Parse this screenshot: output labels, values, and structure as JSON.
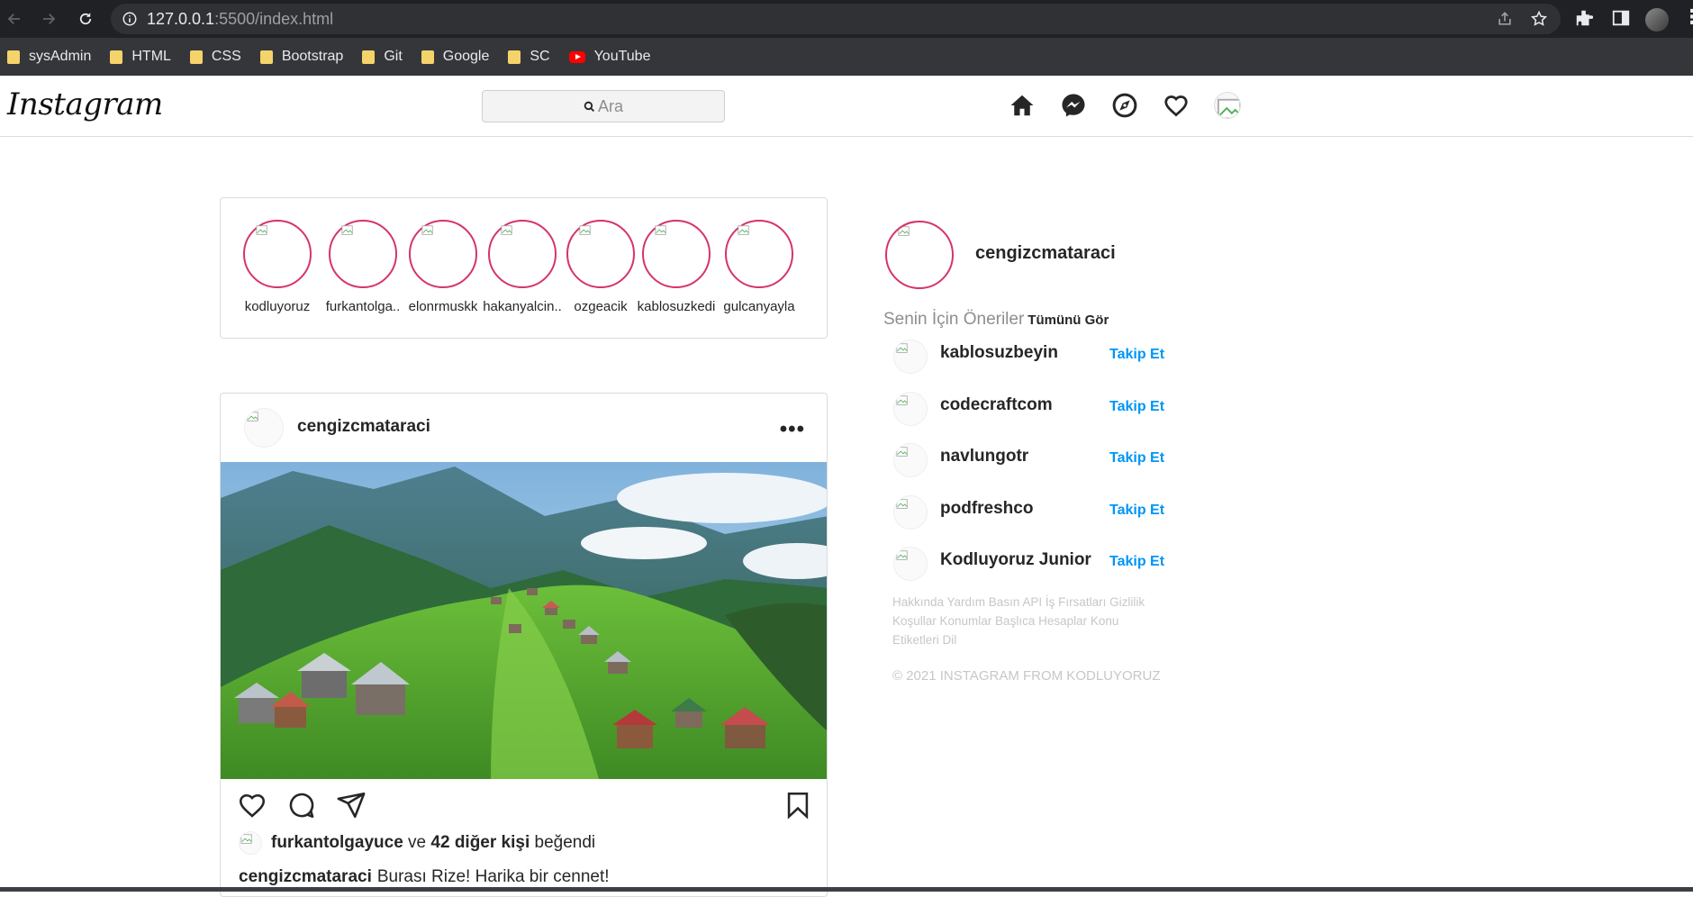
{
  "browser": {
    "url_host": "127.0.0.1",
    "url_path": ":5500/index.html",
    "bookmarks": [
      {
        "label": "sysAdmin",
        "icon": "folder-icon"
      },
      {
        "label": "HTML",
        "icon": "folder-icon"
      },
      {
        "label": "CSS",
        "icon": "folder-icon"
      },
      {
        "label": "Bootstrap",
        "icon": "folder-icon"
      },
      {
        "label": "Git",
        "icon": "folder-icon"
      },
      {
        "label": "Google",
        "icon": "folder-icon"
      },
      {
        "label": "SC",
        "icon": "folder-icon"
      },
      {
        "label": "YouTube",
        "icon": "youtube-icon"
      }
    ]
  },
  "header": {
    "logo": "Instagram",
    "search_placeholder": "Ara"
  },
  "stories": [
    "kodluyoruz",
    "furkantolga..",
    "elonrmuskk",
    "hakanyalcin..",
    "ozgeacik",
    "kablosuzkedi",
    "gulcanyayla"
  ],
  "post": {
    "username": "cengizcmataraci",
    "more": "•••",
    "liked_by": "furkantolgayuce",
    "liked_and": "ve",
    "liked_others": "42 diğer kişi",
    "liked_suffix": "beğendi",
    "caption_user": "cengizcmataraci",
    "caption_text": "Burası Rize! Harika bir cennet!"
  },
  "sidebar": {
    "username": "cengizcmataraci",
    "suggestions_title": "Senin İçin Öneriler",
    "see_all": "Tümünü Gör",
    "follow_label": "Takip Et",
    "suggestions": [
      "kablosuzbeyin",
      "codecraftcom",
      "navlungotr",
      "podfreshco",
      "Kodluyoruz Junior"
    ],
    "footer_links": "Hakkında Yardım Basın API İş Fırsatları Gizlilik Koşullar Konumlar Başlıca Hesaplar Konu Etiketleri Dil",
    "copyright": "© 2021 INSTAGRAM FROM KODLUYORUZ"
  }
}
